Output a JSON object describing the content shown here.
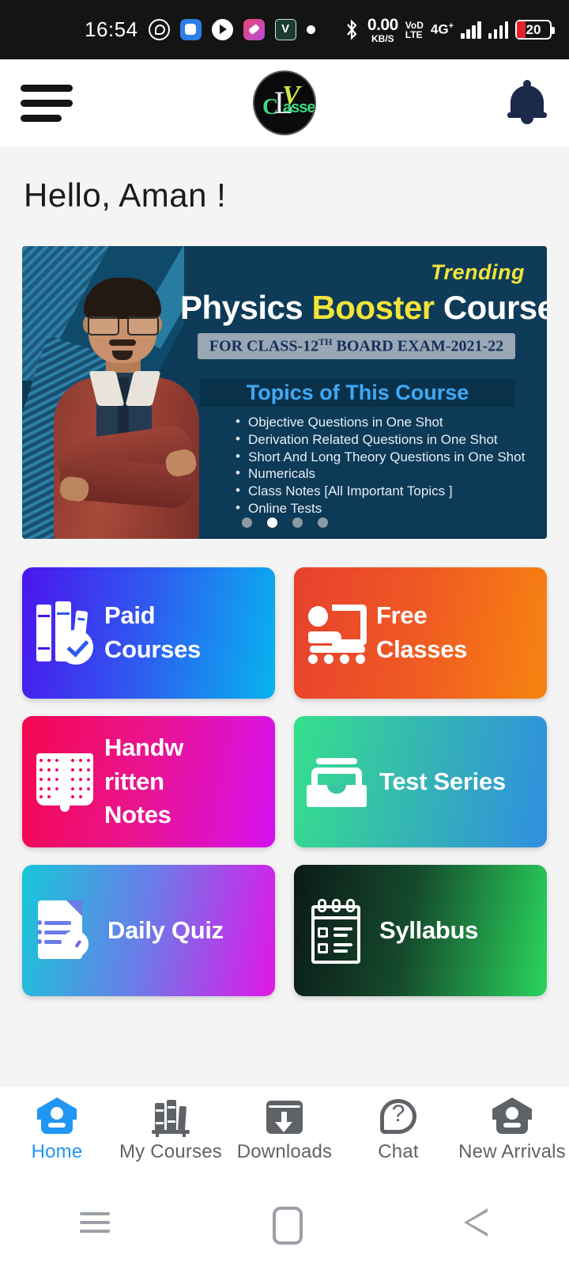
{
  "statusbar": {
    "time": "16:54",
    "network_speed_value": "0.00",
    "network_speed_unit": "KB/S",
    "volte_line1": "VoD",
    "volte_line2": "LTE",
    "network_type": "4G",
    "network_type_sup": "+",
    "battery_percent": "20",
    "app_icons": [
      "whatsapp-icon",
      "blue-app-icon",
      "video-player-icon",
      "editor-app-icon",
      "vn-app-icon",
      "dot-notification-icon"
    ]
  },
  "appbar": {
    "menu_icon": "hamburger-menu-icon",
    "logo": {
      "c": "C",
      "l": "L",
      "v": "V",
      "asses": "asses",
      "alt": "LV Classes"
    },
    "notification_icon": "bell-icon"
  },
  "main": {
    "greeting": "Hello, Aman !"
  },
  "banner": {
    "trending_label": "Trending",
    "title_part1": "Physics ",
    "title_highlight": "Booster",
    "title_part2": " Course",
    "subtitle_pre": "FOR CLASS-12",
    "subtitle_sup": "TH",
    "subtitle_post": " BOARD EXAM-2021-22",
    "topics_heading": "Topics of This Course",
    "topics": [
      "Objective Questions in One Shot",
      "Derivation Related  Questions in One Shot",
      "Short And Long Theory Questions in One Shot",
      "Numericals",
      "Class Notes [All Important Topics ]",
      "Online Tests"
    ],
    "dots_total": 4,
    "dots_active_index": 1
  },
  "tiles": [
    {
      "label_line1": "Paid",
      "label_line2": "Courses",
      "icon": "paid-courses-icon",
      "class": "t-paid",
      "name": "tile-paid-courses",
      "colors": [
        "#4a15ee",
        "#07b4ef"
      ]
    },
    {
      "label_line1": "Free",
      "label_line2": "Classes",
      "icon": "free-classes-icon",
      "class": "t-free",
      "name": "tile-free-classes",
      "colors": [
        "#e8402f",
        "#f78410"
      ]
    },
    {
      "label_line1": "Handw",
      "label_line2": "ritten",
      "label_line3": "Notes",
      "icon": "handwritten-notes-icon",
      "class": "t-notes",
      "name": "tile-handwritten-notes",
      "colors": [
        "#f5074f",
        "#d510f0"
      ]
    },
    {
      "label_line1": "Test Series",
      "icon": "test-series-icon",
      "class": "t-test",
      "name": "tile-test-series",
      "colors": [
        "#35e08c",
        "#2f8ee0"
      ]
    },
    {
      "label_line1": "Daily Quiz",
      "icon": "daily-quiz-icon",
      "class": "t-quiz",
      "name": "tile-daily-quiz",
      "colors": [
        "#17c7d8",
        "#e116e8"
      ]
    },
    {
      "label_line1": "Syllabus",
      "icon": "syllabus-icon",
      "class": "t-syll",
      "name": "tile-syllabus",
      "colors": [
        "#0b1a18",
        "#2bd65d"
      ]
    }
  ],
  "bottom_nav": {
    "active_color": "#2196f3",
    "inactive_color": "#5f6368",
    "items": [
      {
        "label": "Home",
        "icon": "home-icon",
        "active": true
      },
      {
        "label": "My Courses",
        "icon": "books-icon",
        "active": false
      },
      {
        "label": "Downloads",
        "icon": "download-box-icon",
        "active": false
      },
      {
        "label": "Chat",
        "icon": "question-chat-icon",
        "active": false
      },
      {
        "label": "New Arrivals",
        "icon": "home-new-icon",
        "active": false
      }
    ]
  },
  "system_nav": {
    "recents": "recents-icon",
    "home": "home-square-icon",
    "back": "back-triangle-icon"
  }
}
